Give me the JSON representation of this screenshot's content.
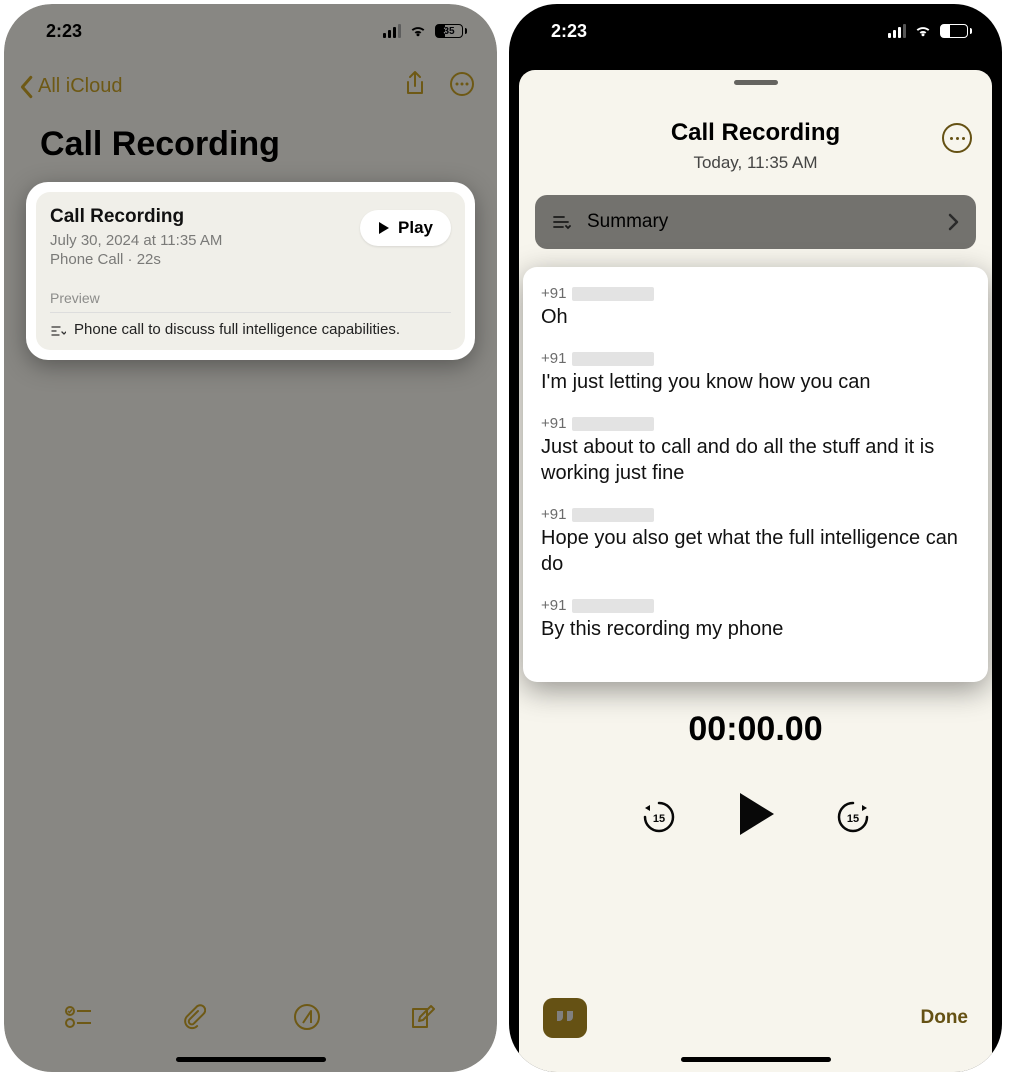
{
  "status": {
    "time": "2:23",
    "battery": "35"
  },
  "left": {
    "back_label": "All iCloud",
    "title": "Call Recording",
    "card": {
      "title": "Call Recording",
      "date": "July 30, 2024 at 11:35 AM",
      "meta": "Phone Call · 22s",
      "play_label": "Play",
      "preview_label": "Preview",
      "preview_text": "Phone call to discuss full intelligence capabilities."
    }
  },
  "right": {
    "title": "Call Recording",
    "subtitle": "Today, 11:35 AM",
    "summary_label": "Summary",
    "transcript": [
      {
        "speaker": "+91",
        "text": "Oh"
      },
      {
        "speaker": "+91",
        "text": "I'm just letting you know how you can"
      },
      {
        "speaker": "+91",
        "text": "Just about to call and do all the stuff and it is working just fine"
      },
      {
        "speaker": "+91",
        "text": "Hope you also get what the full intelligence can do"
      },
      {
        "speaker": "+91",
        "text": "By this recording my phone"
      }
    ],
    "timecode": "00:00.00",
    "skip_seconds": "15",
    "done_label": "Done"
  }
}
